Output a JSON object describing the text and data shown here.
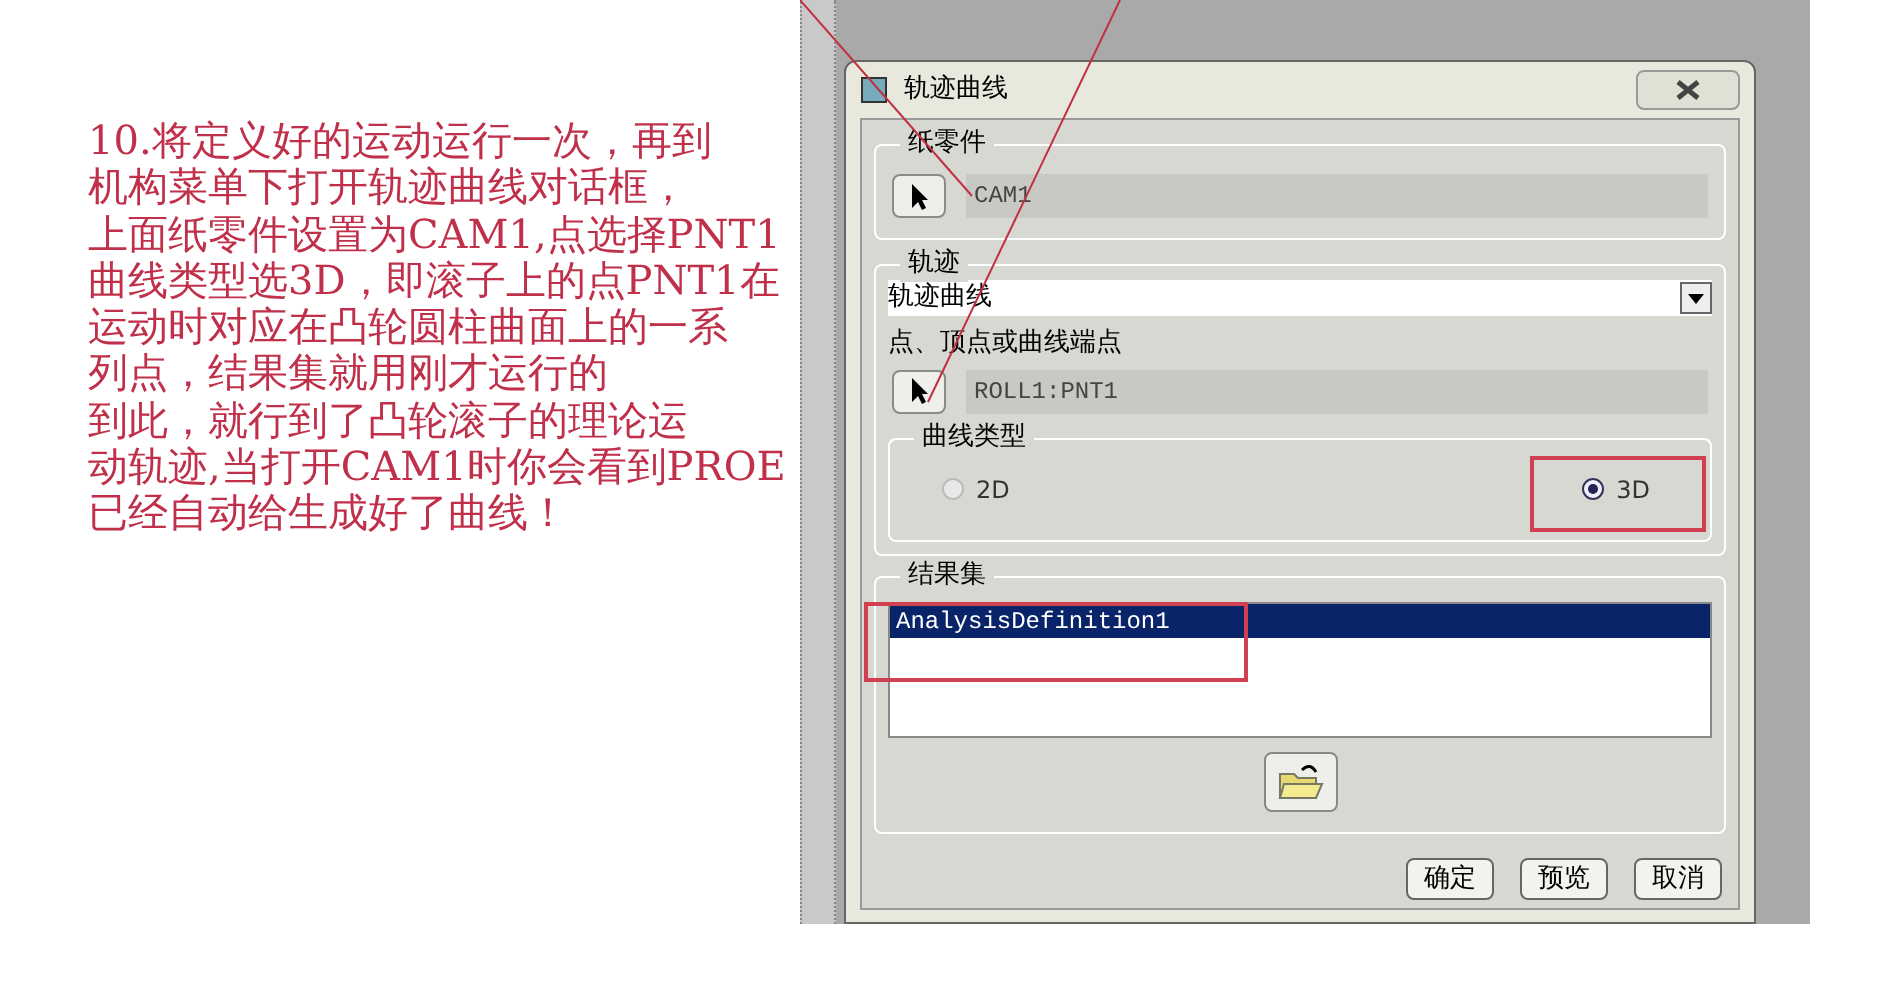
{
  "annotation": {
    "lines": [
      "10.将定义好的运动运行一次，再到",
      "机构菜单下打开轨迹曲线对话框，",
      "上面纸零件设置为CAM1,点选择PNT1",
      "曲线类型选3D，即滚子上的点PNT1在",
      "运动时对应在凸轮圆柱曲面上的一系",
      "列点，结果集就用刚才运行的",
      "到此，就行到了凸轮滚子的理论运",
      "动轨迹,当打开CAM1时你会看到PROE",
      "已经自动给生成好了曲线！"
    ]
  },
  "dialog": {
    "title": "轨迹曲线",
    "paper_part": {
      "label": "纸零件",
      "value": "CAM1"
    },
    "trajectory": {
      "label": "轨迹",
      "dropdown_value": "轨迹曲线",
      "point_label": "点、顶点或曲线端点",
      "point_value": "ROLL1:PNT1",
      "curve_type": {
        "label": "曲线类型",
        "options": [
          {
            "label": "2D",
            "selected": false
          },
          {
            "label": "3D",
            "selected": true
          }
        ]
      }
    },
    "result_set": {
      "label": "结果集",
      "items": [
        {
          "label": "AnalysisDefinition1",
          "selected": true
        }
      ]
    },
    "buttons": [
      "确定",
      "预览",
      "取消"
    ]
  }
}
